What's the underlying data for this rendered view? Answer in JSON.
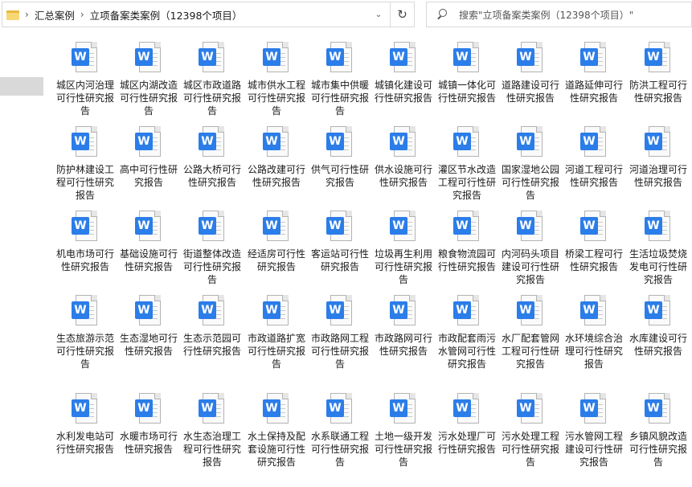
{
  "breadcrumb": {
    "items": [
      "汇总案例",
      "立项备案类案例（12398个项目）"
    ],
    "separator": "›",
    "dropdown_icon": "⌄"
  },
  "toolbar": {
    "refresh_icon": "↻"
  },
  "search": {
    "placeholder": "搜索\"立项备案类案例（12398个项目）\""
  },
  "file_icon_letter": "W",
  "files": [
    "城区内河治理可行性研究报告",
    "城区内湖改造可行性研究报告",
    "城区市政道路可行性研究报告",
    "城市供水工程可行性研究报告",
    "城市集中供暖可行性研究报告",
    "城镇化建设可行性研究报告",
    "城镇一体化可行性研究报告",
    "道路建设可行性研究报告",
    "道路延伸可行性研究报告",
    "防洪工程可行性研究报告",
    "防护林建设工程可行性研究报告",
    "高中可行性研究报告",
    "公路大桥可行性研究报告",
    "公路改建可行性研究报告",
    "供气可行性研究报告",
    "供水设施可行性研究报告",
    "灌区节水改造工程可行性研究报告",
    "国家湿地公园可行性研究报告",
    "河道工程可行性研究报告",
    "河道治理可行性研究报告",
    "机电市场可行性研究报告",
    "基础设施可行性研究报告",
    "街道整体改造可行性研究报告",
    "经适房可行性研究报告",
    "客运站可行性研究报告",
    "垃圾再生利用可行性研究报告",
    "粮食物流园可行性研究报告",
    "内河码头项目建设可行性研究报告",
    "桥梁工程可行性研究报告",
    "生活垃圾焚烧发电可行性研究报告",
    "生态旅游示范可行性研究报告",
    "生态湿地可行性研究报告",
    "生态示范园可行性研究报告",
    "市政道路扩宽可行性研究报告",
    "市政路网工程可行性研究报告",
    "市政路网可行性研究报告",
    "市政配套雨污水管网可行性研究报告",
    "水厂配套管网工程可行性研究报告",
    "水环境综合治理可行性研究报告",
    "水库建设可行性研究报告",
    "水利发电站可行性研究报告",
    "水暖市场可行性研究报告",
    "水生态治理工程可行性研究报告",
    "水土保持及配套设施可行性研究报告",
    "水系联通工程可行性研究报告",
    "土地一级开发可行性研究报告",
    "污水处理厂可行性研究报告",
    "污水处理工程可行性研究报告",
    "污水管网工程建设可行性研究报告",
    "乡镇风貌改造可行性研究报告"
  ]
}
